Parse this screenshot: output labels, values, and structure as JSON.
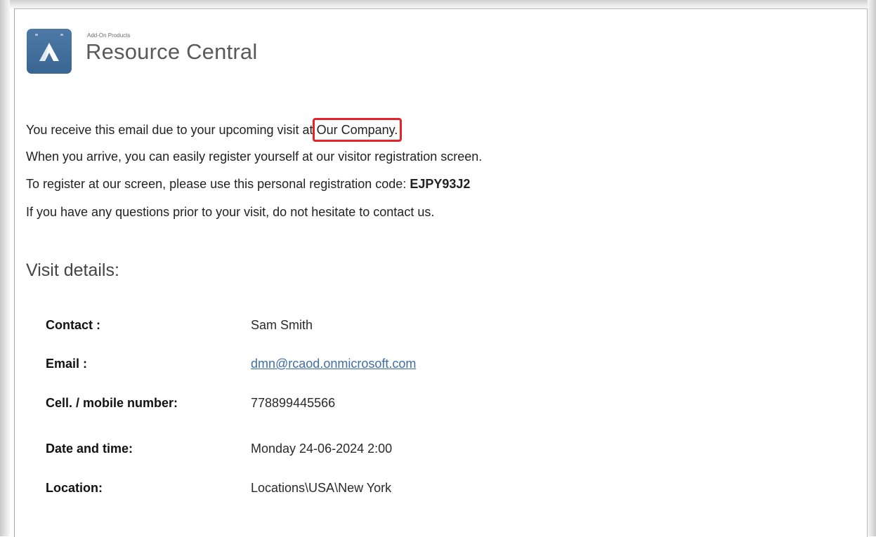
{
  "brand": {
    "small_label": "Add-On Products",
    "title": "Resource Central",
    "logo_icon": "delta-triangle-icon",
    "logo_color": "#44719e"
  },
  "message": {
    "line1_prefix": "You receive this email due to your upcoming visit at",
    "company": "Our Company.",
    "line2": "When you arrive, you can easily register yourself at our visitor registration screen.",
    "line3_prefix": "To register at our screen, please use this personal registration code:",
    "registration_code": "EJPY93J2",
    "line4": "If you have any questions prior to your visit, do not hesitate to contact us."
  },
  "visit_details": {
    "title": "Visit details:",
    "rows": [
      {
        "label": "Contact :",
        "value": "Sam Smith"
      },
      {
        "label": "Email :",
        "value": "dmn@rcaod.onmicrosoft.com"
      },
      {
        "label": "Cell. / mobile number:",
        "value": "778899445566"
      },
      {
        "label": "Date and time:",
        "value": "Monday 24-06-2024 2:00"
      },
      {
        "label": "Location:",
        "value": "Locations\\USA\\New York"
      }
    ]
  },
  "colors": {
    "highlight_border": "#e4242a",
    "link": "#3f6ea5"
  }
}
